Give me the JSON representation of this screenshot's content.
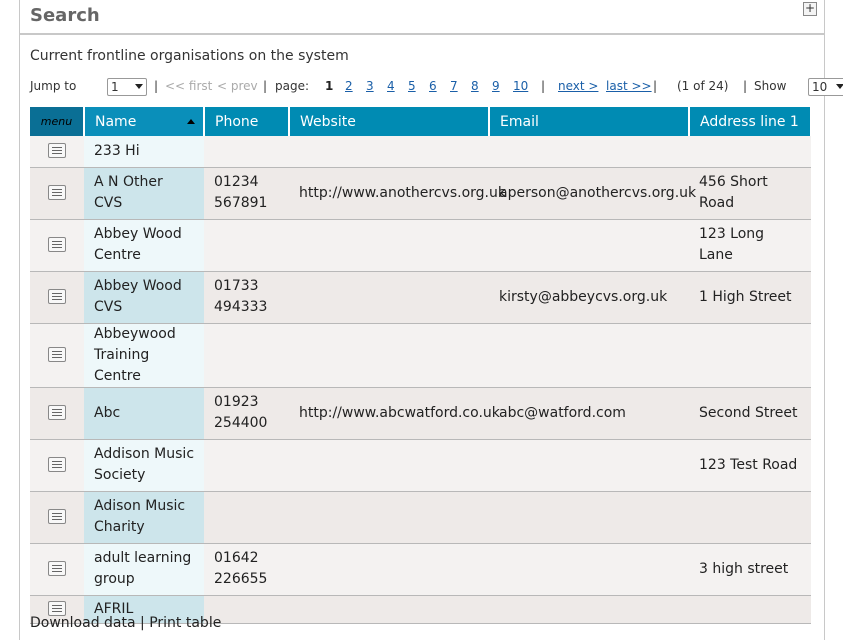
{
  "panel": {
    "title": "Search",
    "expand_symbol": "+"
  },
  "subtitle": "Current frontline organisations on the system",
  "pager": {
    "jump_label": "Jump to",
    "jump_value": "1",
    "first": "<< first",
    "prev": "< prev",
    "page_label": "page:",
    "current_page": "1",
    "pages": [
      "2",
      "3",
      "4",
      "5",
      "6",
      "7",
      "8",
      "9",
      "10"
    ],
    "next": "next >",
    "last": "last >>",
    "position": "(1 of 24)",
    "show_label": "Show",
    "show_value": "10",
    "sep": "|"
  },
  "table": {
    "headers": {
      "menu": "menu",
      "name": "Name",
      "phone": "Phone",
      "website": "Website",
      "email": "Email",
      "address": "Address line 1"
    },
    "rows": [
      {
        "name": "233 Hi",
        "phone": "",
        "website": "",
        "email": "",
        "address": ""
      },
      {
        "name": "A N Other CVS",
        "phone": "01234 567891",
        "website": "http://www.anothercvs.org.uk",
        "email": "aperson@anothercvs.org.uk",
        "address": "456 Short Road"
      },
      {
        "name": "Abbey Wood Centre",
        "phone": "",
        "website": "",
        "email": "",
        "address": "123 Long Lane"
      },
      {
        "name": "Abbey Wood CVS",
        "phone": "01733 494333",
        "website": "",
        "email": "kirsty@abbeycvs.org.uk",
        "address": "1 High Street"
      },
      {
        "name": "Abbeywood Training Centre",
        "phone": "",
        "website": "",
        "email": "",
        "address": ""
      },
      {
        "name": "Abc",
        "phone": "01923 254400",
        "website": "http://www.abcwatford.co.uk",
        "email": "abc@watford.com",
        "address": "Second Street"
      },
      {
        "name": "Addison Music Society",
        "phone": "",
        "website": "",
        "email": "",
        "address": "123 Test Road"
      },
      {
        "name": "Adison Music Charity",
        "phone": "",
        "website": "",
        "email": "",
        "address": ""
      },
      {
        "name": "adult learning group",
        "phone": "01642 226655",
        "website": "",
        "email": "",
        "address": "3 high street"
      },
      {
        "name": "AFRIL",
        "phone": "",
        "website": "",
        "email": "",
        "address": ""
      }
    ]
  },
  "footer": {
    "download": "Download data",
    "separator": "|",
    "print": "Print table"
  },
  "colors": {
    "header_bg": "#008bb3",
    "menu_header_bg": "#0a6f95",
    "link": "#1a5fa8"
  }
}
